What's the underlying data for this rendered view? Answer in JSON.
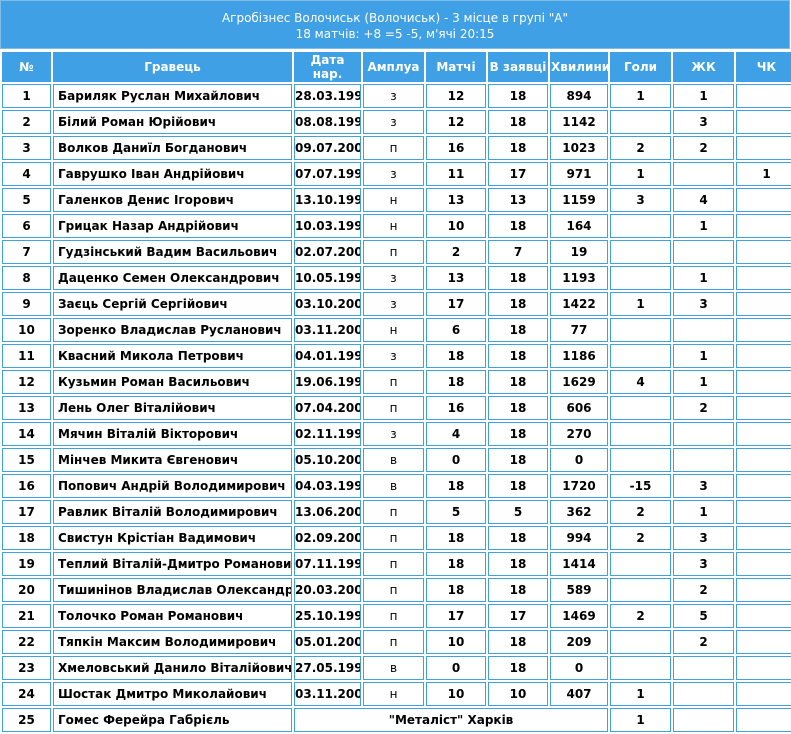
{
  "title": {
    "line1": "Агробізнес Волочиськ (Волочиськ) - 3 місце в групі \"А\"",
    "line2": "18 матчів: +8 =5 -5, м'ячі 20:15"
  },
  "columns": [
    "№",
    "Гравець",
    "Дата нар.",
    "Амплуа",
    "Матчі",
    "В заявці",
    "Хвилини",
    "Голи",
    "ЖК",
    "ЧК"
  ],
  "rows": [
    {
      "n": "1",
      "name": "Бариляк Руслан Михайлович",
      "dob": "28.03.1998",
      "pos": "з",
      "matches": "12",
      "squad": "18",
      "minutes": "894",
      "goals": "1",
      "yc": "1",
      "rc": ""
    },
    {
      "n": "2",
      "name": "Білий Роман Юрійович",
      "dob": "08.08.1999",
      "pos": "з",
      "matches": "12",
      "squad": "18",
      "minutes": "1142",
      "goals": "",
      "yc": "3",
      "rc": ""
    },
    {
      "n": "3",
      "name": "Волков Даниїл Богданович",
      "dob": "09.07.2002",
      "pos": "п",
      "matches": "16",
      "squad": "18",
      "minutes": "1023",
      "goals": "2",
      "yc": "2",
      "rc": ""
    },
    {
      "n": "4",
      "name": "Гаврушко Іван Андрійович",
      "dob": "07.07.1998",
      "pos": "з",
      "matches": "11",
      "squad": "17",
      "minutes": "971",
      "goals": "1",
      "yc": "",
      "rc": "1"
    },
    {
      "n": "5",
      "name": "Галенков Денис Ігорович",
      "dob": "13.10.1995",
      "pos": "н",
      "matches": "13",
      "squad": "13",
      "minutes": "1159",
      "goals": "3",
      "yc": "4",
      "rc": ""
    },
    {
      "n": "6",
      "name": "Грицак Назар Андрійович",
      "dob": "10.03.1999",
      "pos": "н",
      "matches": "10",
      "squad": "18",
      "minutes": "164",
      "goals": "",
      "yc": "1",
      "rc": ""
    },
    {
      "n": "7",
      "name": "Гудзінський Вадим Васильович",
      "dob": "02.07.2001",
      "pos": "п",
      "matches": "2",
      "squad": "7",
      "minutes": "19",
      "goals": "",
      "yc": "",
      "rc": ""
    },
    {
      "n": "8",
      "name": "Даценко Семен Олександрович",
      "dob": "10.05.1994",
      "pos": "з",
      "matches": "13",
      "squad": "18",
      "minutes": "1193",
      "goals": "",
      "yc": "1",
      "rc": ""
    },
    {
      "n": "9",
      "name": "Заєць Сергій Сергійович",
      "dob": "03.10.2001",
      "pos": "з",
      "matches": "17",
      "squad": "18",
      "minutes": "1422",
      "goals": "1",
      "yc": "3",
      "rc": ""
    },
    {
      "n": "10",
      "name": "Зоренко Владислав Русланович",
      "dob": "03.11.2001",
      "pos": "н",
      "matches": "6",
      "squad": "18",
      "minutes": "77",
      "goals": "",
      "yc": "",
      "rc": ""
    },
    {
      "n": "11",
      "name": "Квасний Микола Петрович",
      "dob": "04.01.1995",
      "pos": "з",
      "matches": "18",
      "squad": "18",
      "minutes": "1186",
      "goals": "",
      "yc": "1",
      "rc": ""
    },
    {
      "n": "12",
      "name": "Кузьмин Роман Васильович",
      "dob": "19.06.1996",
      "pos": "п",
      "matches": "18",
      "squad": "18",
      "minutes": "1629",
      "goals": "4",
      "yc": "1",
      "rc": ""
    },
    {
      "n": "13",
      "name": "Лень Олег Віталійович",
      "dob": "07.04.2002",
      "pos": "п",
      "matches": "16",
      "squad": "18",
      "minutes": "606",
      "goals": "",
      "yc": "2",
      "rc": ""
    },
    {
      "n": "14",
      "name": "Мячин Віталій Вікторович",
      "dob": "02.11.1996",
      "pos": "з",
      "matches": "4",
      "squad": "18",
      "minutes": "270",
      "goals": "",
      "yc": "",
      "rc": ""
    },
    {
      "n": "15",
      "name": "Мінчев Микита Євгенович",
      "dob": "05.10.2003",
      "pos": "в",
      "matches": "0",
      "squad": "18",
      "minutes": "0",
      "goals": "",
      "yc": "",
      "rc": ""
    },
    {
      "n": "16",
      "name": "Попович Андрій Володимирович",
      "dob": "04.03.1992",
      "pos": "в",
      "matches": "18",
      "squad": "18",
      "minutes": "1720",
      "goals": "-15",
      "yc": "3",
      "rc": ""
    },
    {
      "n": "17",
      "name": "Равлик Віталій Володимирович",
      "dob": "13.06.2000",
      "pos": "п",
      "matches": "5",
      "squad": "5",
      "minutes": "362",
      "goals": "2",
      "yc": "1",
      "rc": ""
    },
    {
      "n": "18",
      "name": "Свистун Крістіан Вадимович",
      "dob": "02.09.2003",
      "pos": "п",
      "matches": "18",
      "squad": "18",
      "minutes": "994",
      "goals": "2",
      "yc": "3",
      "rc": ""
    },
    {
      "n": "19",
      "name": "Теплий Віталій-Дмитро Романович",
      "dob": "07.11.1998",
      "pos": "п",
      "matches": "18",
      "squad": "18",
      "minutes": "1414",
      "goals": "",
      "yc": "3",
      "rc": ""
    },
    {
      "n": "20",
      "name": "Тишинінов Владислав Олександрович",
      "dob": "20.03.2000",
      "pos": "п",
      "matches": "18",
      "squad": "18",
      "minutes": "589",
      "goals": "",
      "yc": "2",
      "rc": ""
    },
    {
      "n": "21",
      "name": "Толочко Роман Романович",
      "dob": "25.10.1998",
      "pos": "п",
      "matches": "17",
      "squad": "17",
      "minutes": "1469",
      "goals": "2",
      "yc": "5",
      "rc": ""
    },
    {
      "n": "22",
      "name": "Тяпкін Максим Володимирович",
      "dob": "05.01.2001",
      "pos": "п",
      "matches": "10",
      "squad": "18",
      "minutes": "209",
      "goals": "",
      "yc": "2",
      "rc": ""
    },
    {
      "n": "23",
      "name": "Хмеловський Данило Віталійович",
      "dob": "27.05.1999",
      "pos": "в",
      "matches": "0",
      "squad": "18",
      "minutes": "0",
      "goals": "",
      "yc": "",
      "rc": ""
    },
    {
      "n": "24",
      "name": "Шостак Дмитро Миколайович",
      "dob": "03.11.2003",
      "pos": "н",
      "matches": "10",
      "squad": "10",
      "minutes": "407",
      "goals": "1",
      "yc": "",
      "rc": ""
    }
  ],
  "last_row": {
    "n": "25",
    "name": "Гомес Ферейра Габрієль",
    "note": "\"Металіст\" Харків",
    "goals": "1"
  },
  "colors": {
    "header_bg": "#3fa0e6",
    "border": "#3fa0e6",
    "accent": "#8dc63f"
  }
}
